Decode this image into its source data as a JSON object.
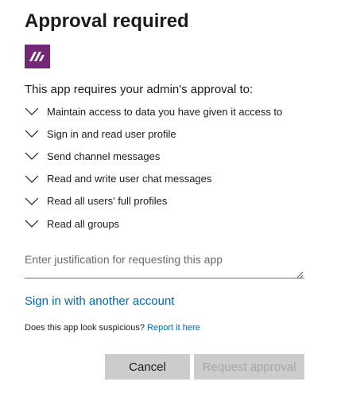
{
  "dialog": {
    "title": "Approval required",
    "intro": "This app requires your admin's approval to:",
    "permissions": [
      {
        "label": "Maintain access to data you have given it access to"
      },
      {
        "label": "Sign in and read user profile"
      },
      {
        "label": "Send channel messages"
      },
      {
        "label": "Read and write user chat messages"
      },
      {
        "label": "Read all users' full profiles"
      },
      {
        "label": "Read all groups"
      }
    ],
    "justification": {
      "placeholder": "Enter justification for requesting this app",
      "value": ""
    },
    "another_account_link": "Sign in with another account",
    "suspicious_text": "Does this app look suspicious?",
    "report_link": "Report it here",
    "cancel_label": "Cancel",
    "request_label": "Request approval"
  },
  "icons": {
    "app_logo": "power-automate-logo-icon",
    "permission_expand": "chevron-down-icon",
    "resize": "resize-grip-icon"
  },
  "colors": {
    "app_logo_bg": "#742774",
    "link": "#0067b8",
    "button_bg": "#cccccc",
    "disabled_text": "#a6a6a6",
    "text": "#1b1b1b"
  }
}
